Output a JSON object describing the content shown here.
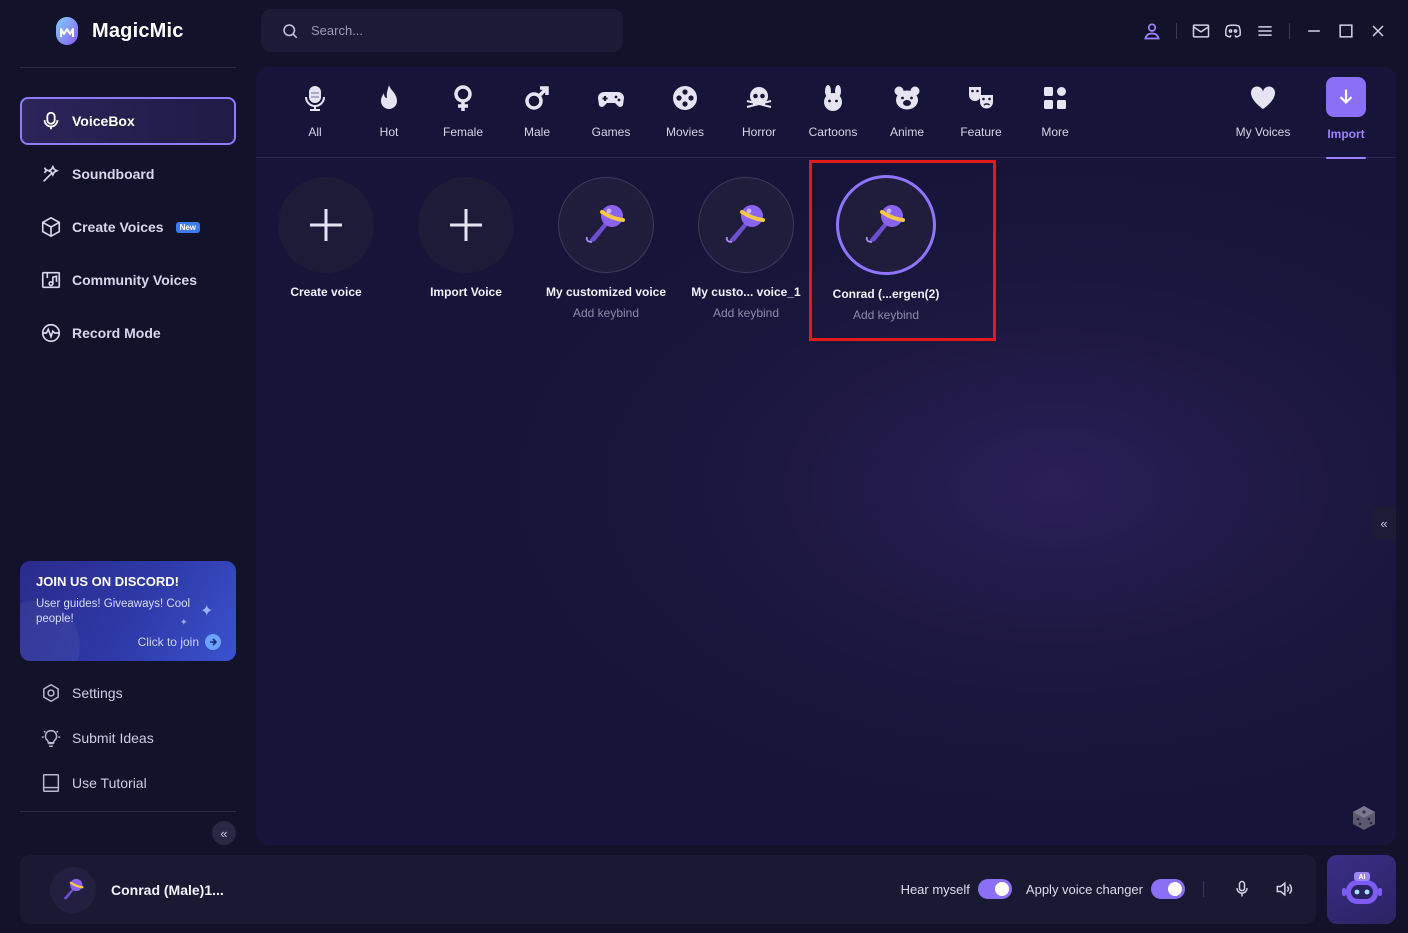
{
  "app": {
    "title": "MagicMic"
  },
  "search": {
    "placeholder": "Search..."
  },
  "sidebar": {
    "items": [
      {
        "label": "VoiceBox",
        "icon": "microphone-icon",
        "active": true
      },
      {
        "label": "Soundboard",
        "icon": "sparkle-wand-icon"
      },
      {
        "label": "Create Voices",
        "icon": "cube-icon",
        "badge": "New"
      },
      {
        "label": "Community Voices",
        "icon": "music-folder-icon"
      },
      {
        "label": "Record Mode",
        "icon": "record-wave-icon"
      }
    ],
    "discord": {
      "title": "JOIN US ON DISCORD!",
      "text": "User guides! Giveaways! Cool people!",
      "cta": "Click to join"
    },
    "secondary": [
      {
        "label": "Settings",
        "icon": "settings-icon"
      },
      {
        "label": "Submit Ideas",
        "icon": "lightbulb-icon"
      },
      {
        "label": "Use Tutorial",
        "icon": "book-icon"
      }
    ]
  },
  "categories": [
    {
      "label": "All",
      "icon": "mic-icon"
    },
    {
      "label": "Hot",
      "icon": "flame-icon"
    },
    {
      "label": "Female",
      "icon": "female-icon"
    },
    {
      "label": "Male",
      "icon": "male-icon"
    },
    {
      "label": "Games",
      "icon": "gamepad-icon"
    },
    {
      "label": "Movies",
      "icon": "film-reel-icon"
    },
    {
      "label": "Horror",
      "icon": "skull-icon"
    },
    {
      "label": "Cartoons",
      "icon": "bunny-icon"
    },
    {
      "label": "Anime",
      "icon": "bear-icon"
    },
    {
      "label": "Feature",
      "icon": "masks-icon"
    },
    {
      "label": "More",
      "icon": "grid-icon"
    }
  ],
  "right_tabs": [
    {
      "label": "My Voices",
      "icon": "heart-icon"
    },
    {
      "label": "Import",
      "icon": "download-arrow-icon",
      "active": true
    }
  ],
  "voices": [
    {
      "name": "Create voice",
      "type": "add"
    },
    {
      "name": "Import Voice",
      "type": "add"
    },
    {
      "name": "My customized voice",
      "sub": "Add keybind",
      "type": "voice"
    },
    {
      "name": "My custo... voice_1",
      "sub": "Add keybind",
      "type": "voice"
    },
    {
      "name": "Conrad (...ergen(2)",
      "sub": "Add keybind",
      "type": "voice",
      "selected": true
    }
  ],
  "bottom": {
    "current_voice": "Conrad (Male)1...",
    "hear_myself": {
      "label": "Hear myself",
      "on": true
    },
    "apply_changer": {
      "label": "Apply voice changer",
      "on": true
    },
    "ai_badge": "AI"
  },
  "colors": {
    "accent": "#8b6ff6",
    "highlight": "#e21a1a",
    "background": "#13122b"
  }
}
